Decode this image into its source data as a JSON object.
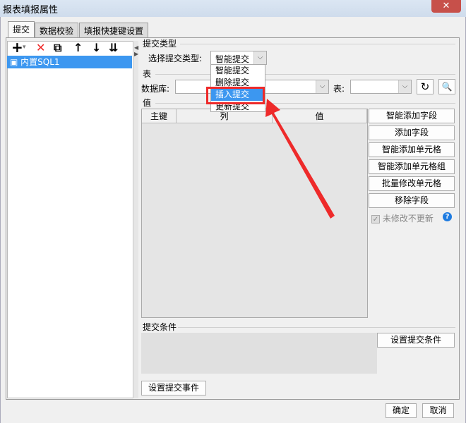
{
  "window": {
    "title": "报表填报属性",
    "close": "✕"
  },
  "tabs": [
    {
      "label": "提交"
    },
    {
      "label": "数据校验"
    },
    {
      "label": "填报快捷键设置"
    }
  ],
  "toolbar": {
    "add": "+",
    "add_dd": "▾",
    "delete": "✕",
    "copy": "⧉",
    "up": "↑",
    "down": "↓",
    "bottom": "⇊"
  },
  "tree": {
    "items": [
      {
        "label": "内置SQL1"
      }
    ]
  },
  "submit_type": {
    "section": "提交类型",
    "label": "选择提交类型:",
    "value": "智能提交",
    "options": [
      "智能提交",
      "删除提交",
      "插入提交",
      "更新提交"
    ],
    "highlighted": "插入提交"
  },
  "table": {
    "section": "表",
    "db_label": "数据库:",
    "table_label": "表:"
  },
  "values": {
    "section": "值",
    "columns": [
      "主键",
      "列",
      "值"
    ]
  },
  "side_buttons": [
    "智能添加字段",
    "添加字段",
    "智能添加单元格",
    "智能添加单元格组",
    "批量修改单元格",
    "移除字段"
  ],
  "checkbox": {
    "label": "未修改不更新",
    "checked": true
  },
  "condition": {
    "section": "提交条件",
    "button": "设置提交条件"
  },
  "event_button": "设置提交事件",
  "footer": {
    "ok": "确定",
    "cancel": "取消"
  },
  "colors": {
    "accent": "#3c97f0",
    "annotation": "#ee2a2a"
  }
}
